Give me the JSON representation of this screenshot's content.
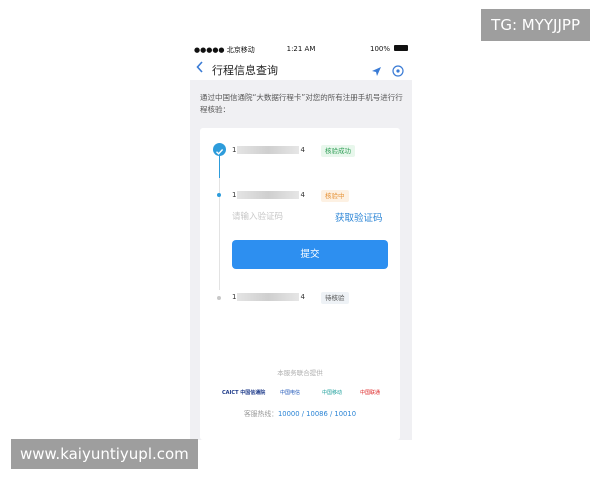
{
  "watermark": {
    "tag": "TG: MYYJJPP",
    "url": "www.kaiyuntiyupl.com"
  },
  "status_bar": {
    "carrier": "●●●●● 北京移动 ",
    "time": "1:21 AM",
    "battery": "100%"
  },
  "nav": {
    "title": "行程信息查询"
  },
  "intro": "通过中国信通院“大数据行程卡”对您的所有注册手机号进行行程核验：",
  "items": [
    {
      "number_start": "1",
      "number_end": "4",
      "status": "核验成功"
    },
    {
      "number_start": "1",
      "number_end": "4",
      "status": "核验中"
    },
    {
      "number_start": "1",
      "number_end": "4",
      "status": "待核验"
    }
  ],
  "verify": {
    "placeholder": "请输入验证码",
    "get_code": "获取验证码",
    "submit": "提交"
  },
  "footer": {
    "provided_by": "本服务联合提供",
    "logos": [
      "CAICT 中国信通院",
      "中国电信",
      "中国移动",
      "中国联通"
    ],
    "hotline_label": "客服热线：",
    "hotline_numbers": "10000 / 10086 / 10010"
  },
  "colors": {
    "primary": "#2d8ff0",
    "success": "#2f9e56",
    "warning": "#e6943a",
    "page_bg": "#f0f0f3"
  }
}
